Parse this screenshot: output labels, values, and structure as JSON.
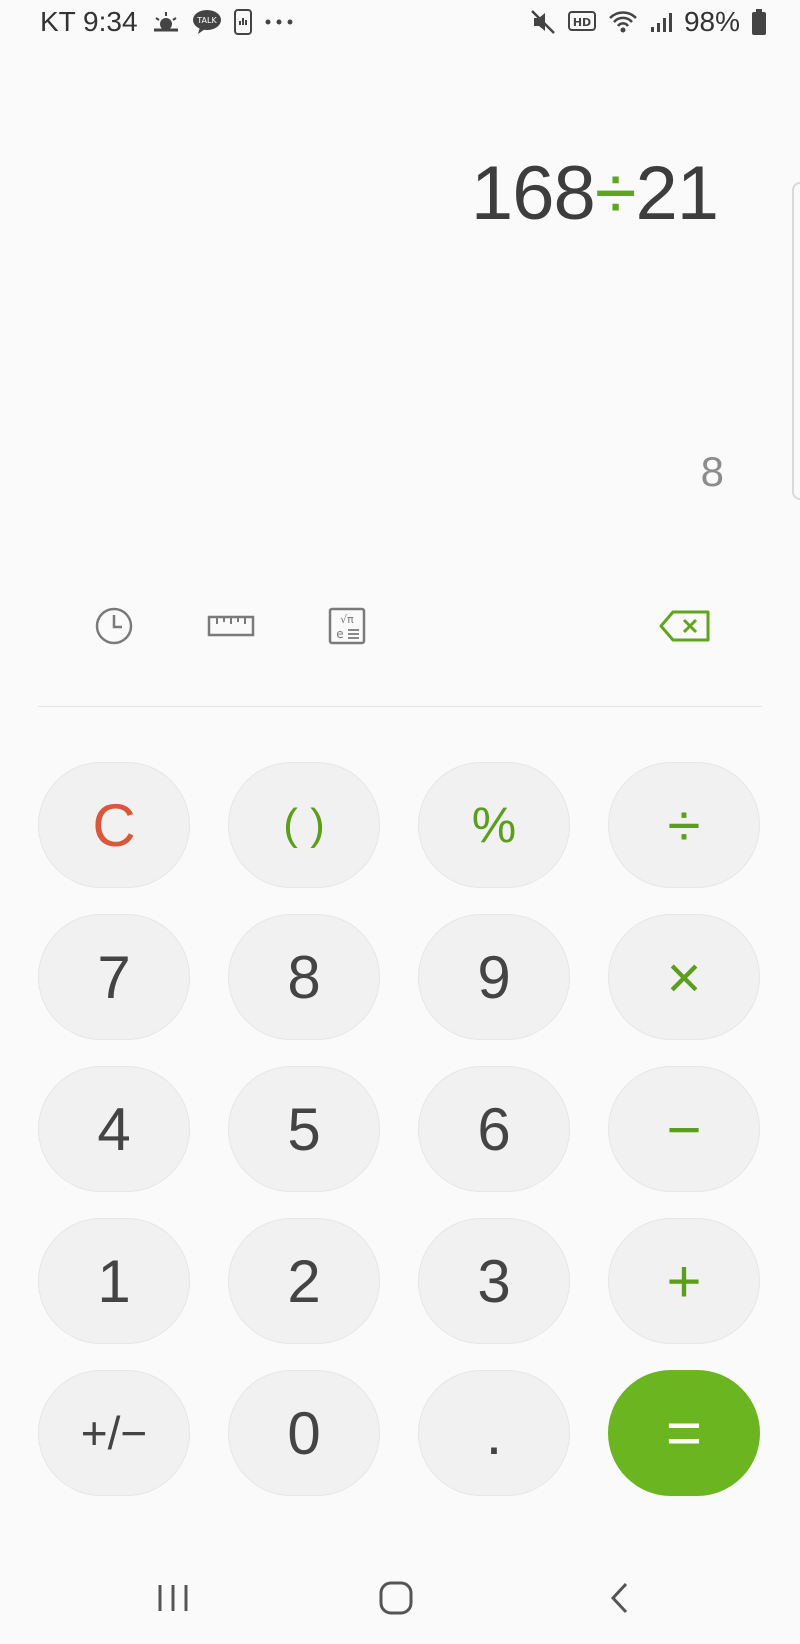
{
  "status_bar": {
    "carrier_time": "KT 9:34",
    "battery_text": "98%",
    "icons": [
      "weather-icon",
      "kakaotalk-icon",
      "device-icon",
      "more-dots-icon",
      "mute-icon",
      "hd-icon",
      "wifi-icon",
      "signal-icon",
      "battery-icon"
    ]
  },
  "display": {
    "operand_a": "168",
    "operator": "÷",
    "operand_b": "21",
    "result": "8"
  },
  "tools": {
    "history_icon": "history-clock-icon",
    "unit_converter_icon": "ruler-icon",
    "scientific_icon": "scientific-mode-icon",
    "backspace_icon": "backspace-icon"
  },
  "keypad": {
    "clear": "C",
    "parentheses": "( )",
    "percent": "%",
    "divide": "÷",
    "seven": "7",
    "eight": "8",
    "nine": "9",
    "multiply": "×",
    "four": "4",
    "five": "5",
    "six": "6",
    "minus": "−",
    "one": "1",
    "two": "2",
    "three": "3",
    "plus": "+",
    "plus_minus": "+/−",
    "zero": "0",
    "decimal": ".",
    "equals": "="
  },
  "nav_bar": {
    "icons": [
      "recent-apps-icon",
      "home-icon",
      "back-icon"
    ]
  },
  "colors": {
    "accent": "#6ab520",
    "clear": "#d9573a",
    "background": "#fafafa",
    "key": "#f1f1f1"
  }
}
